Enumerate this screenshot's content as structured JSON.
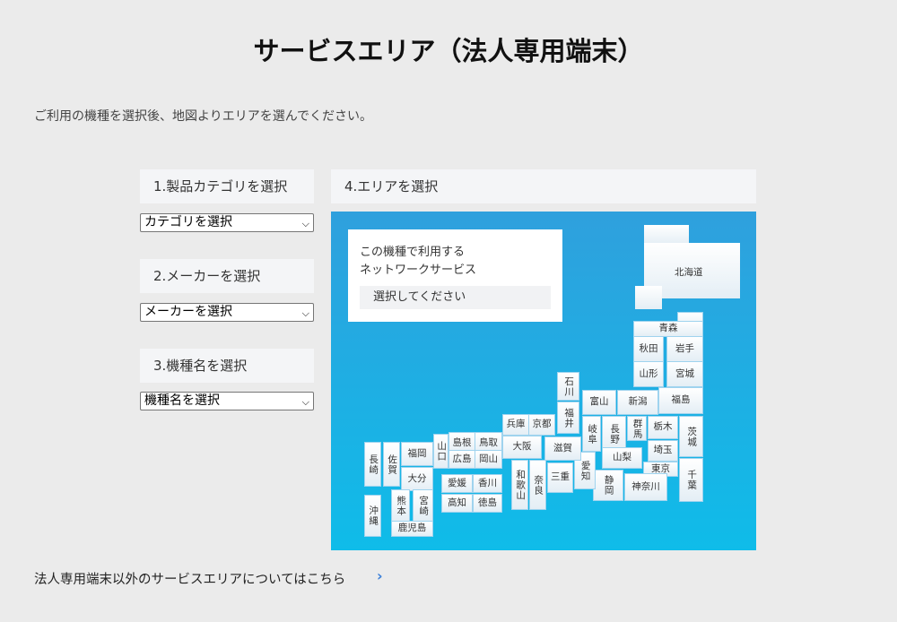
{
  "page": {
    "title": "サービスエリア（法人専用端末）",
    "description": "ご利用の機種を選択後、地図よりエリアを選んでください。"
  },
  "steps": {
    "category": {
      "label": "1.製品カテゴリを選択",
      "selected": "カテゴリを選択"
    },
    "maker": {
      "label": "2.メーカーを選択",
      "selected": "メーカーを選択"
    },
    "model": {
      "label": "3.機種名を選択",
      "selected": "機種名を選択"
    },
    "area": {
      "label": "4.エリアを選択"
    }
  },
  "service_box": {
    "line1": "この機種で利用する",
    "line2": "ネットワークサービス",
    "select_label": "選択してください"
  },
  "prefectures": {
    "hokkaido": "北海道",
    "aomori": "青森",
    "akita": "秋田",
    "iwate": "岩手",
    "yamagata": "山形",
    "miyagi": "宮城",
    "fukushima": "福島",
    "niigata": "新潟",
    "toyama": "富山",
    "ishikawa": "石川",
    "fukui": "福井",
    "gifu": "岐阜",
    "nagano": "長野",
    "gunma": "群馬",
    "tochigi": "栃木",
    "ibaraki": "茨城",
    "saitama": "埼玉",
    "yamanashi": "山梨",
    "tokyo": "東京",
    "chiba": "千葉",
    "kanagawa": "神奈川",
    "shizuoka": "静岡",
    "aichi": "愛知",
    "mie": "三重",
    "shiga": "滋賀",
    "kyoto": "京都",
    "hyogo": "兵庫",
    "osaka": "大阪",
    "nara": "奈良",
    "wakayama": "和歌山",
    "tottori": "鳥取",
    "shimane": "島根",
    "okayama": "岡山",
    "hiroshima": "広島",
    "yamaguchi": "山口",
    "kagawa": "香川",
    "ehime": "愛媛",
    "tokushima": "徳島",
    "kochi": "高知",
    "fukuoka": "福岡",
    "saga": "佐賀",
    "nagasaki": "長崎",
    "oita": "大分",
    "kumamoto": "熊本",
    "miyazaki": "宮崎",
    "kagoshima": "鹿児島",
    "okinawa": "沖縄"
  },
  "footer": {
    "link_text": "法人専用端末以外のサービスエリアについてはこちら",
    "link_icon": "chevron-right-icon"
  },
  "colors": {
    "map_top": "#2fa0dd",
    "map_bottom": "#0fbce9",
    "link_arrow": "#3a7fd9"
  }
}
